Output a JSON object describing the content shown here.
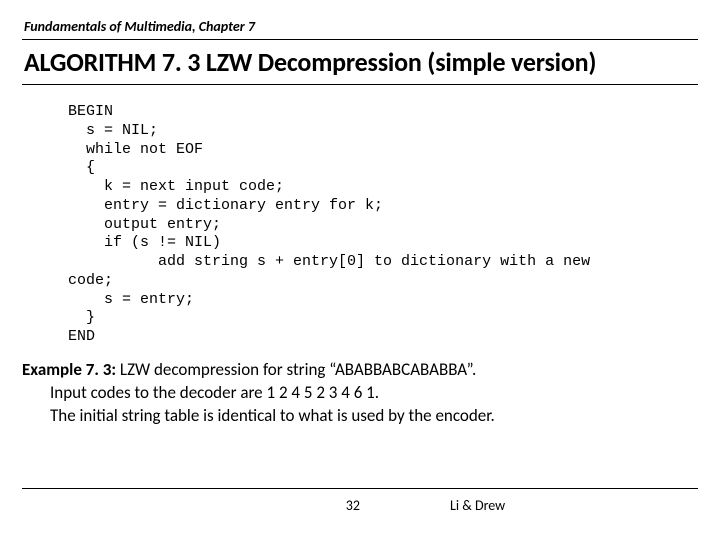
{
  "chapter": "Fundamentals of Multimedia, Chapter 7",
  "title": "ALGORITHM 7. 3 LZW Decompression (simple version)",
  "code": "BEGIN\n  s = NIL;\n  while not EOF\n  {\n    k = next input code;\n    entry = dictionary entry for k;\n    output entry;\n    if (s != NIL)\n          add string s + entry[0] to dictionary with a new\ncode;\n    s = entry;\n  }\nEND",
  "example": {
    "lead": "Example 7. 3:",
    "line1_rest": " LZW decompression for string “ABABBABCABABBA”.",
    "line2": "Input codes to the decoder are 1 2 4 5 2 3 4 6 1.",
    "line3": "The initial string table is identical to what is used by the encoder."
  },
  "page_number": "32",
  "authors": "Li & Drew"
}
